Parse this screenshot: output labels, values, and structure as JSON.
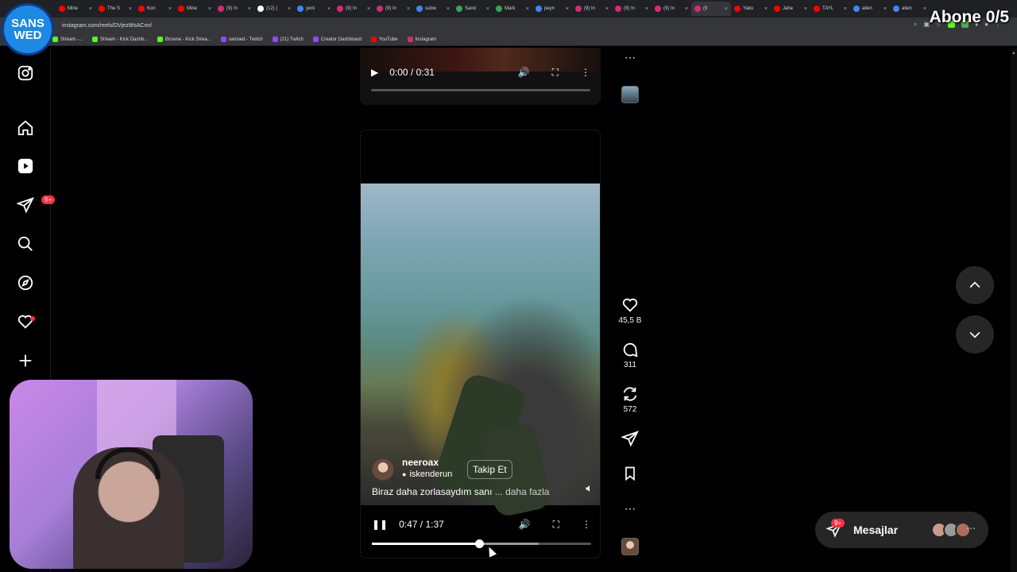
{
  "browser": {
    "tabs": [
      {
        "label": "Mine",
        "color": "#ff0000"
      },
      {
        "label": "The S",
        "color": "#ff0000"
      },
      {
        "label": "Kon",
        "color": "#ff0000"
      },
      {
        "label": "Mine",
        "color": "#ff0000"
      },
      {
        "label": "(9) In",
        "color": "#d62976"
      },
      {
        "label": "(12) (",
        "color": "#ffffff"
      },
      {
        "label": "yeni",
        "color": "#4285f4"
      },
      {
        "label": "(9) In",
        "color": "#d62976"
      },
      {
        "label": "(9) In",
        "color": "#d62976"
      },
      {
        "label": "subw",
        "color": "#4285f4"
      },
      {
        "label": "Sand",
        "color": "#34a853"
      },
      {
        "label": "Mark",
        "color": "#34a853"
      },
      {
        "label": "peyn",
        "color": "#4285f4"
      },
      {
        "label": "(9) In",
        "color": "#d62976"
      },
      {
        "label": "(9) In",
        "color": "#d62976"
      },
      {
        "label": "(9) In",
        "color": "#d62976"
      },
      {
        "label": "(9",
        "color": "#d62976",
        "active": true
      },
      {
        "label": "Yaku",
        "color": "#ff0000"
      },
      {
        "label": "Jahe",
        "color": "#ff0000"
      },
      {
        "label": "TAYL",
        "color": "#ff0000"
      },
      {
        "label": "alien",
        "color": "#4285f4"
      },
      {
        "label": "alien",
        "color": "#4285f4"
      }
    ],
    "url": "instagram.com/reels/DVjezWsACnn/",
    "bookmarks": [
      {
        "label": "Stream -...",
        "color": "#53fc18"
      },
      {
        "label": "Stream - Kick Dashb...",
        "color": "#53fc18"
      },
      {
        "label": "Browse - Kick Strea...",
        "color": "#53fc18"
      },
      {
        "label": "sansied - Twitch",
        "color": "#9146ff"
      },
      {
        "label": "(21) Twitch",
        "color": "#9146ff"
      },
      {
        "label": "Creator Dashboard",
        "color": "#9146ff"
      },
      {
        "label": "YouTube",
        "color": "#ff0000"
      },
      {
        "label": "Instagram",
        "color": "#d62976"
      }
    ]
  },
  "overlay": {
    "logo_line1": "SANS",
    "logo_line2": "WED",
    "abone": "Abone 0/5"
  },
  "sidebar": {
    "notifications_badge": "9+"
  },
  "reel_prev": {
    "time": "0:00 / 0:31",
    "progress": 0
  },
  "reel_main": {
    "username": "neeroax",
    "location": "iskenderun",
    "follow_label": "Takip Et",
    "caption": "Biraz daha zorlasaydım sanı",
    "more_label": "... daha fazla",
    "time": "0:47 / 1:37",
    "progress": 0.49,
    "buffered": 0.76
  },
  "actions": {
    "likes": "45,5 B",
    "comments": "311",
    "reposts": "572"
  },
  "messages": {
    "label": "Mesajlar",
    "badge": "9+"
  }
}
